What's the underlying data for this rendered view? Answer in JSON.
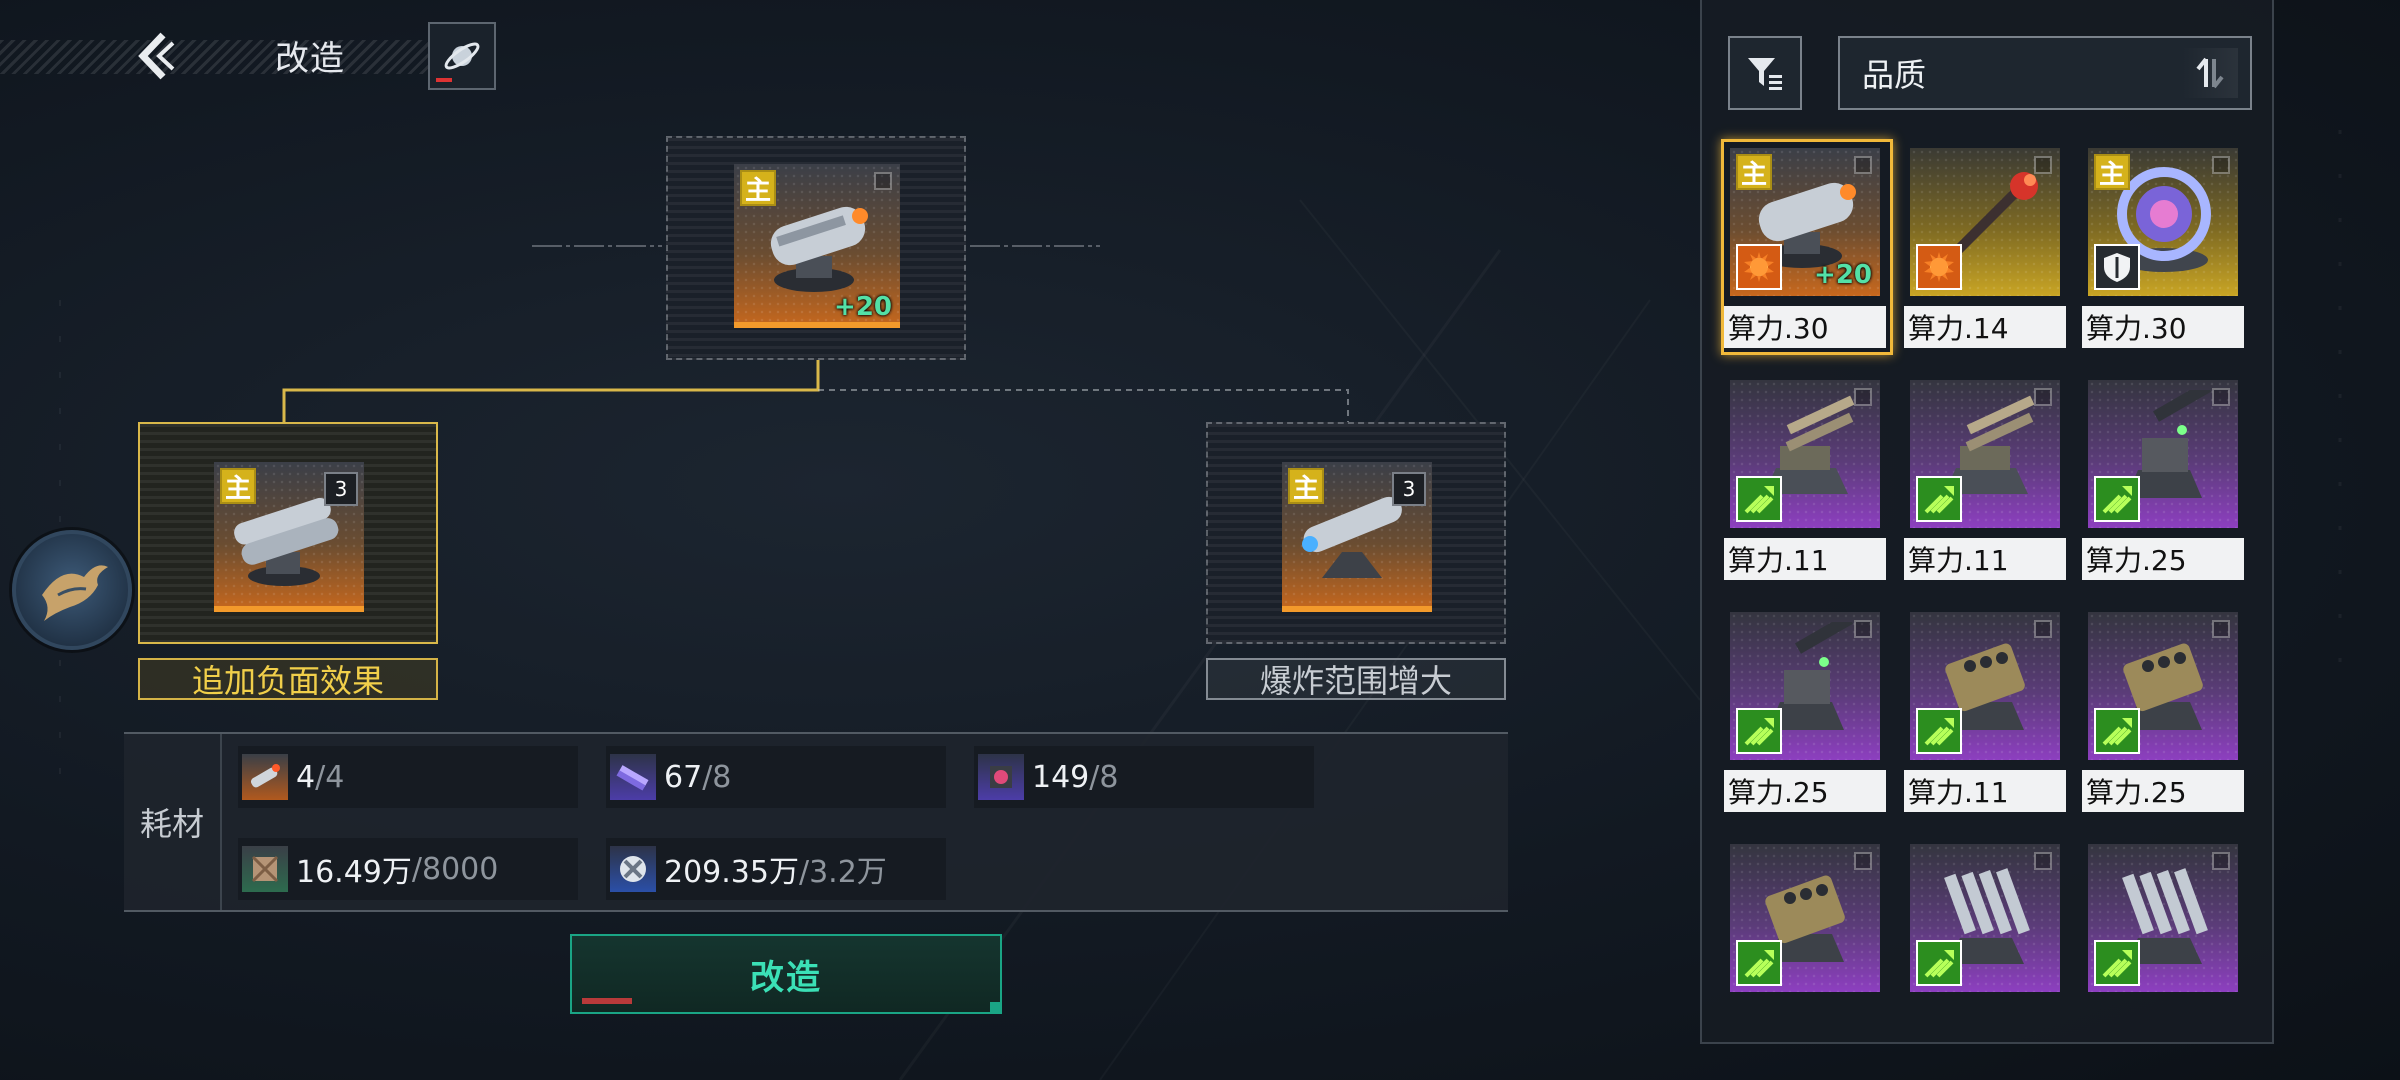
{
  "header": {
    "title": "改造",
    "back_icon": "chevron-left-icon",
    "planet_icon": "planet-icon"
  },
  "tree": {
    "root": {
      "badge": "主",
      "bonus": "+20",
      "rarity": "orange"
    },
    "branches": [
      {
        "badge": "主",
        "level": "3",
        "label": "追加负面效果",
        "active": true
      },
      {
        "badge": "主",
        "level": "3",
        "label": "爆炸范围增大",
        "active": false
      }
    ]
  },
  "materials": {
    "label": "耗材",
    "items": [
      {
        "have": "4",
        "need": "/4",
        "icon": "missile-material-icon"
      },
      {
        "have": "67",
        "need": "/8",
        "icon": "chip-material-icon"
      },
      {
        "have": "149",
        "need": "/8",
        "icon": "core-material-icon"
      },
      {
        "have": "16.49万",
        "need": "/8000",
        "icon": "supply-crate-icon"
      },
      {
        "have": "209.35万",
        "need": "/3.2万",
        "icon": "alloy-coin-icon"
      }
    ]
  },
  "action": {
    "label": "改造"
  },
  "panel": {
    "sort_label": "品质",
    "cards": [
      {
        "power": "算力.30",
        "rarity": "orange",
        "badge": "主",
        "bonus": "+20",
        "skill": "fire",
        "selected": true
      },
      {
        "power": "算力.14",
        "rarity": "gold",
        "badge": "",
        "bonus": "",
        "skill": "fire",
        "selected": false
      },
      {
        "power": "算力.30",
        "rarity": "gold",
        "badge": "主",
        "bonus": "",
        "skill": "shield",
        "selected": false
      },
      {
        "power": "算力.11",
        "rarity": "purple",
        "badge": "",
        "bonus": "",
        "skill": "green",
        "selected": false
      },
      {
        "power": "算力.11",
        "rarity": "purple",
        "badge": "",
        "bonus": "",
        "skill": "green",
        "selected": false
      },
      {
        "power": "算力.25",
        "rarity": "purple",
        "badge": "",
        "bonus": "",
        "skill": "green",
        "selected": false
      },
      {
        "power": "算力.25",
        "rarity": "purple",
        "badge": "",
        "bonus": "",
        "skill": "green",
        "selected": false
      },
      {
        "power": "算力.11",
        "rarity": "purple",
        "badge": "",
        "bonus": "",
        "skill": "green",
        "selected": false
      },
      {
        "power": "算力.25",
        "rarity": "purple",
        "badge": "",
        "bonus": "",
        "skill": "green",
        "selected": false
      },
      {
        "power": "",
        "rarity": "purple",
        "badge": "",
        "bonus": "",
        "skill": "green",
        "selected": false
      },
      {
        "power": "",
        "rarity": "purple",
        "badge": "",
        "bonus": "",
        "skill": "green",
        "selected": false
      },
      {
        "power": "",
        "rarity": "purple",
        "badge": "",
        "bonus": "",
        "skill": "green",
        "selected": false
      }
    ]
  },
  "colors": {
    "accent_gold": "#d9b84a",
    "accent_green": "#3be0b6",
    "orange": "#f39a2b",
    "purple": "#8d3fc0"
  }
}
